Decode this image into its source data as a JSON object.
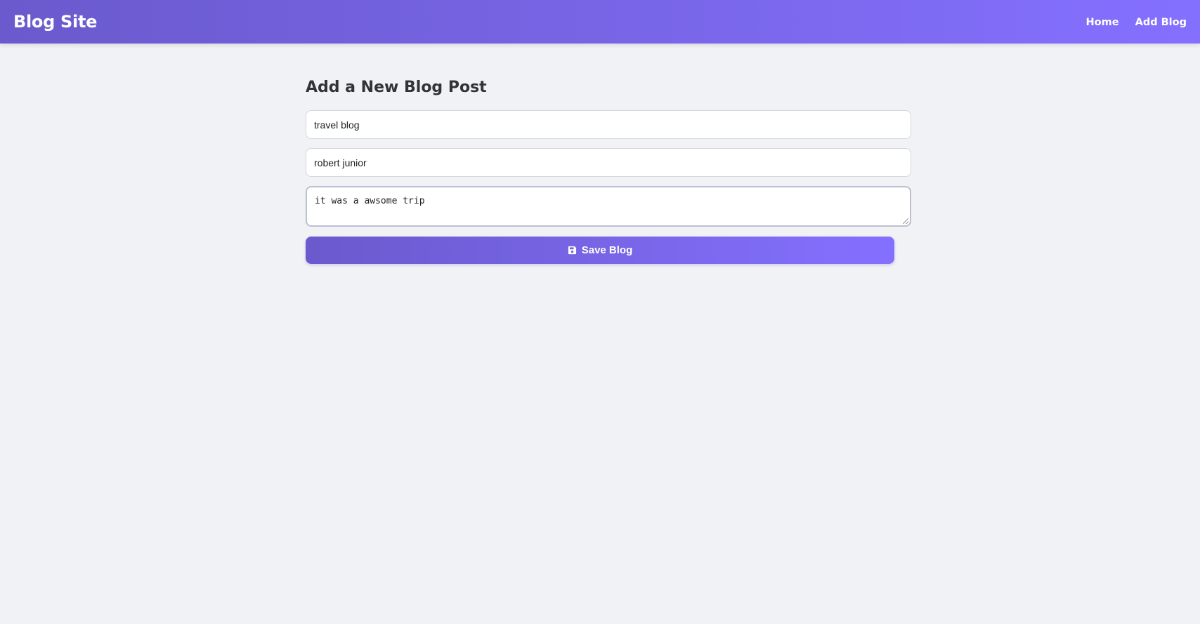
{
  "navbar": {
    "brand": "Blog Site",
    "links": [
      {
        "label": "Home"
      },
      {
        "label": "Add Blog"
      }
    ]
  },
  "form": {
    "heading": "Add a New Blog Post",
    "title_value": "travel blog",
    "author_value": "robert junior",
    "content_value": "it was a awsome trip",
    "save_label": "Save Blog",
    "save_icon": "floppy-disk-icon"
  },
  "colors": {
    "gradient_start": "#6a5acd",
    "gradient_end": "#8470ff",
    "background": "#f0f2f5",
    "heading": "#333333"
  }
}
